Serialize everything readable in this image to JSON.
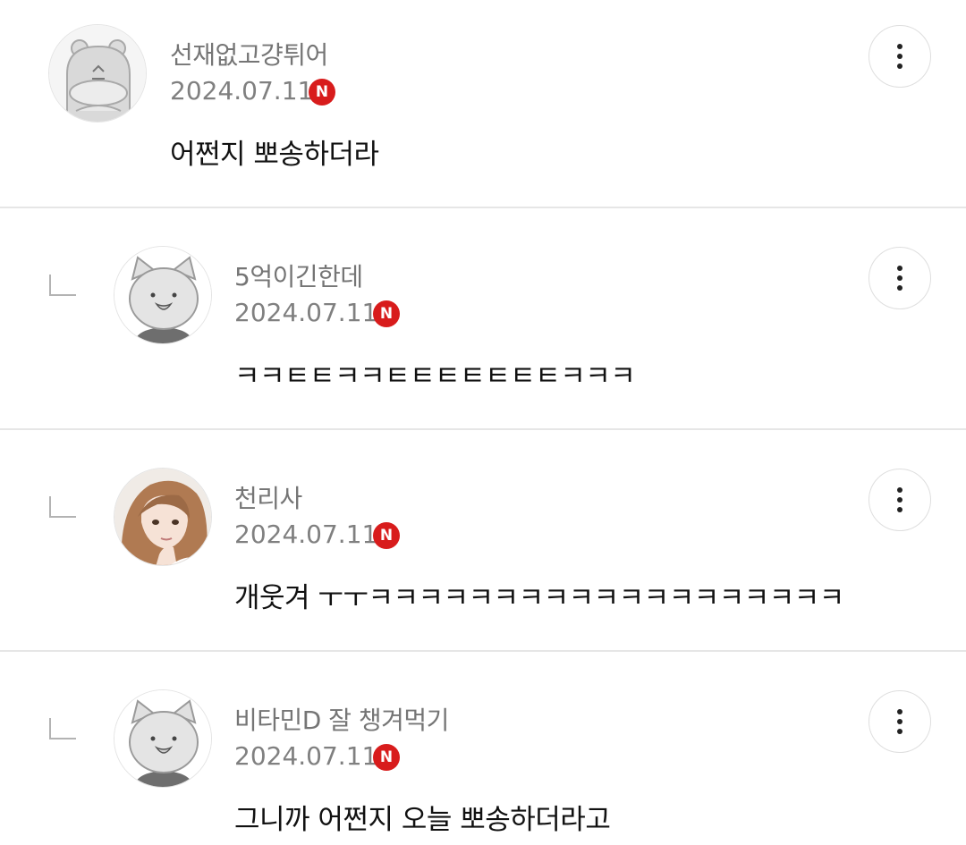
{
  "comments": [
    {
      "username": "선재없고걍튀어",
      "date": "2024.07.11",
      "badge": "N",
      "text": "어쩐지 뽀송하더라",
      "is_reply": false,
      "avatar_icon": "hamster-avatar"
    },
    {
      "username": "5억이긴한데",
      "date": "2024.07.11",
      "badge": "N",
      "text": "ㅋㅋㅌㅌㅋㅋㅌㅌㅌㅌㅌㅌㅌㅋㅋㅋ",
      "is_reply": true,
      "avatar_icon": "cat-avatar"
    },
    {
      "username": "천리사",
      "date": "2024.07.11",
      "badge": "N",
      "text": "개웃겨 ㅜㅜㅋㅋㅋㅋㅋㅋㅋㅋㅋㅋㅋㅋㅋㅋㅋㅋㅋㅋㅋ",
      "is_reply": true,
      "avatar_icon": "girl-portrait-avatar"
    },
    {
      "username": "비타민D 잘 챙겨먹기",
      "date": "2024.07.11",
      "badge": "N",
      "text": "그니까 어쩐지 오늘 뽀송하더라고",
      "is_reply": true,
      "avatar_icon": "cat-avatar"
    }
  ],
  "colors": {
    "badge_red": "#d81c1c",
    "divider": "#e6e6e6",
    "meta_gray": "#808080",
    "body_text": "#111111"
  },
  "icons": {
    "more": "vertical-ellipsis-icon",
    "reply": "reply-corner-icon",
    "badge": "new-badge-icon"
  }
}
